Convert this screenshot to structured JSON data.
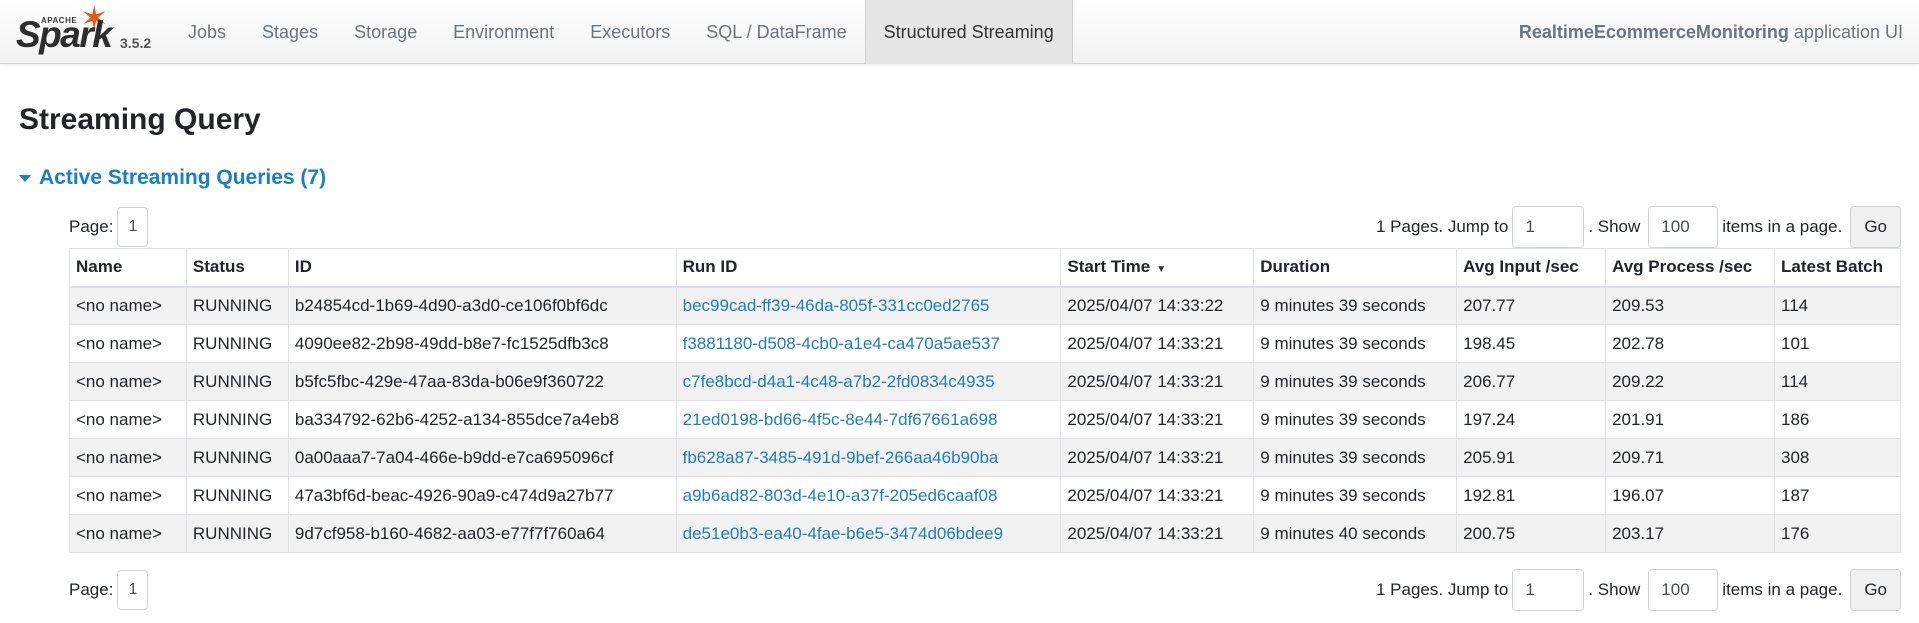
{
  "brand": {
    "apache": "APACHE",
    "name": "Spark",
    "version": "3.5.2"
  },
  "nav": {
    "tabs": [
      {
        "label": "Jobs"
      },
      {
        "label": "Stages"
      },
      {
        "label": "Storage"
      },
      {
        "label": "Environment"
      },
      {
        "label": "Executors"
      },
      {
        "label": "SQL / DataFrame"
      },
      {
        "label": "Structured Streaming",
        "active": true
      }
    ],
    "app_name": "RealtimeEcommerceMonitoring",
    "app_suffix": "application UI"
  },
  "page": {
    "title": "Streaming Query"
  },
  "section": {
    "title": "Active Streaming Queries (7)"
  },
  "pager": {
    "page_label": "Page:",
    "page_value": "1",
    "pages_text": "1 Pages. Jump to",
    "jump_value": "1",
    "show_text": ". Show",
    "show_value": "100",
    "items_text": "items in a page.",
    "go_label": "Go"
  },
  "table": {
    "columns": [
      "Name",
      "Status",
      "ID",
      "Run ID",
      "Start Time",
      "Duration",
      "Avg Input /sec",
      "Avg Process /sec",
      "Latest Batch"
    ],
    "sorted_column": "Start Time",
    "rows": [
      [
        "<no name>",
        "RUNNING",
        "b24854cd-1b69-4d90-a3d0-ce106f0bf6dc",
        "bec99cad-ff39-46da-805f-331cc0ed2765",
        "2025/04/07 14:33:22",
        "9 minutes 39 seconds",
        "207.77",
        "209.53",
        "114"
      ],
      [
        "<no name>",
        "RUNNING",
        "4090ee82-2b98-49dd-b8e7-fc1525dfb3c8",
        "f3881180-d508-4cb0-a1e4-ca470a5ae537",
        "2025/04/07 14:33:21",
        "9 minutes 39 seconds",
        "198.45",
        "202.78",
        "101"
      ],
      [
        "<no name>",
        "RUNNING",
        "b5fc5fbc-429e-47aa-83da-b06e9f360722",
        "c7fe8bcd-d4a1-4c48-a7b2-2fd0834c4935",
        "2025/04/07 14:33:21",
        "9 minutes 39 seconds",
        "206.77",
        "209.22",
        "114"
      ],
      [
        "<no name>",
        "RUNNING",
        "ba334792-62b6-4252-a134-855dce7a4eb8",
        "21ed0198-bd66-4f5c-8e44-7df67661a698",
        "2025/04/07 14:33:21",
        "9 minutes 39 seconds",
        "197.24",
        "201.91",
        "186"
      ],
      [
        "<no name>",
        "RUNNING",
        "0a00aaa7-7a04-466e-b9dd-e7ca695096cf",
        "fb628a87-3485-491d-9bef-266aa46b90ba",
        "2025/04/07 14:33:21",
        "9 minutes 39 seconds",
        "205.91",
        "209.71",
        "308"
      ],
      [
        "<no name>",
        "RUNNING",
        "47a3bf6d-beac-4926-90a9-c474d9a27b77",
        "a9b6ad82-803d-4e10-a37f-205ed6caaf08",
        "2025/04/07 14:33:21",
        "9 minutes 39 seconds",
        "192.81",
        "196.07",
        "187"
      ],
      [
        "<no name>",
        "RUNNING",
        "9d7cf958-b160-4682-aa03-e77f7f760a64",
        "de51e0b3-ea40-4fae-b6e5-3474d06bdee9",
        "2025/04/07 14:33:21",
        "9 minutes 40 seconds",
        "200.75",
        "203.17",
        "176"
      ]
    ]
  },
  "colors": {
    "link": "#1b7fc4",
    "brand_star": "#e25a1c",
    "row_stripe": "#f2f2f2"
  }
}
